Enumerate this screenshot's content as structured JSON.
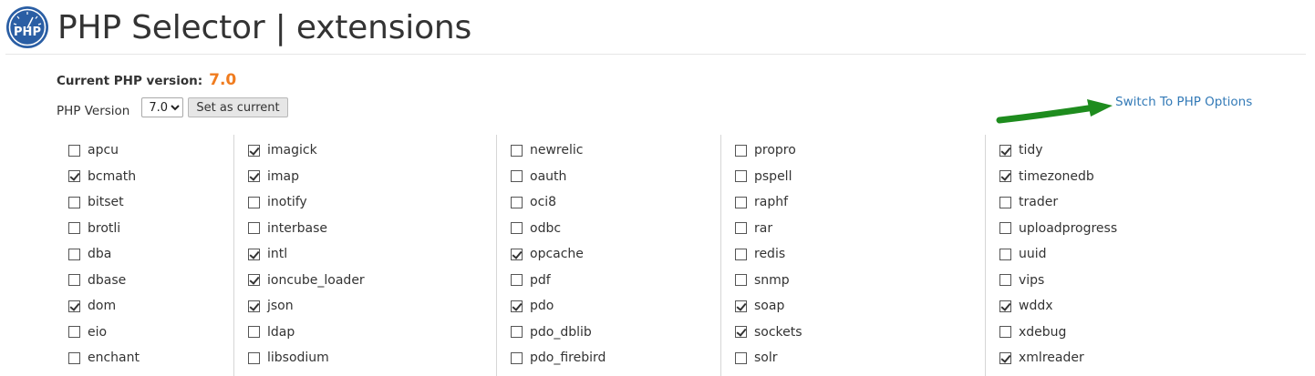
{
  "header": {
    "logo_text": "PHP",
    "title": "PHP Selector | extensions"
  },
  "current": {
    "label": "Current PHP version:",
    "value": "7.0"
  },
  "version": {
    "label": "PHP Version",
    "selected": "7.0",
    "set_button": "Set as current"
  },
  "switch_link": "Switch To PHP Options",
  "colors": {
    "accent": "#f07c1f",
    "link": "#337ab7",
    "arrow": "#1e8c1e",
    "logo": "#2a5ea4"
  },
  "columns": [
    [
      {
        "name": "apcu",
        "checked": false
      },
      {
        "name": "bcmath",
        "checked": true
      },
      {
        "name": "bitset",
        "checked": false
      },
      {
        "name": "brotli",
        "checked": false
      },
      {
        "name": "dba",
        "checked": false
      },
      {
        "name": "dbase",
        "checked": false
      },
      {
        "name": "dom",
        "checked": true
      },
      {
        "name": "eio",
        "checked": false
      },
      {
        "name": "enchant",
        "checked": false
      }
    ],
    [
      {
        "name": "imagick",
        "checked": true
      },
      {
        "name": "imap",
        "checked": true
      },
      {
        "name": "inotify",
        "checked": false
      },
      {
        "name": "interbase",
        "checked": false
      },
      {
        "name": "intl",
        "checked": true
      },
      {
        "name": "ioncube_loader",
        "checked": true
      },
      {
        "name": "json",
        "checked": true
      },
      {
        "name": "ldap",
        "checked": false
      },
      {
        "name": "libsodium",
        "checked": false
      }
    ],
    [
      {
        "name": "newrelic",
        "checked": false
      },
      {
        "name": "oauth",
        "checked": false
      },
      {
        "name": "oci8",
        "checked": false
      },
      {
        "name": "odbc",
        "checked": false
      },
      {
        "name": "opcache",
        "checked": true
      },
      {
        "name": "pdf",
        "checked": false
      },
      {
        "name": "pdo",
        "checked": true
      },
      {
        "name": "pdo_dblib",
        "checked": false
      },
      {
        "name": "pdo_firebird",
        "checked": false
      }
    ],
    [
      {
        "name": "propro",
        "checked": false
      },
      {
        "name": "pspell",
        "checked": false
      },
      {
        "name": "raphf",
        "checked": false
      },
      {
        "name": "rar",
        "checked": false
      },
      {
        "name": "redis",
        "checked": false
      },
      {
        "name": "snmp",
        "checked": false
      },
      {
        "name": "soap",
        "checked": true
      },
      {
        "name": "sockets",
        "checked": true
      },
      {
        "name": "solr",
        "checked": false
      }
    ],
    [
      {
        "name": "tidy",
        "checked": true
      },
      {
        "name": "timezonedb",
        "checked": true
      },
      {
        "name": "trader",
        "checked": false
      },
      {
        "name": "uploadprogress",
        "checked": false
      },
      {
        "name": "uuid",
        "checked": false
      },
      {
        "name": "vips",
        "checked": false
      },
      {
        "name": "wddx",
        "checked": true
      },
      {
        "name": "xdebug",
        "checked": false
      },
      {
        "name": "xmlreader",
        "checked": true
      }
    ]
  ]
}
